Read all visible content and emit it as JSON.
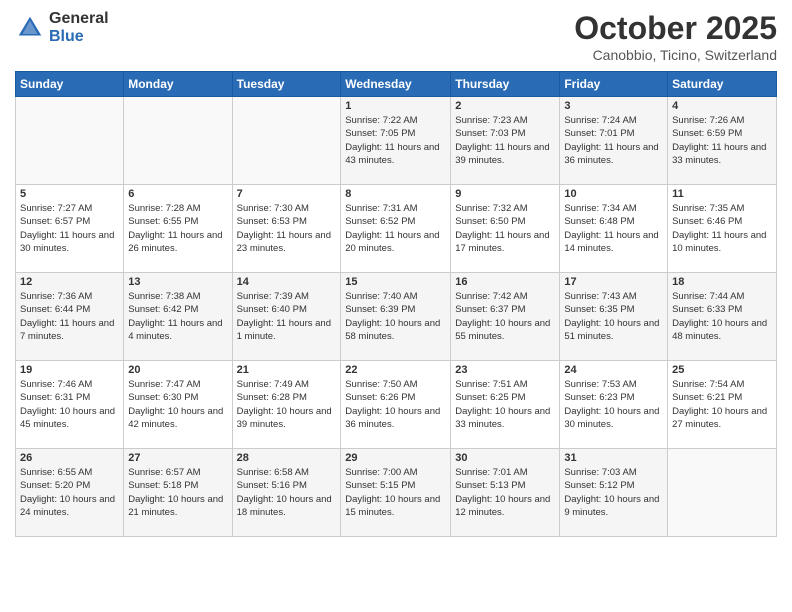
{
  "header": {
    "logo_general": "General",
    "logo_blue": "Blue",
    "title": "October 2025",
    "location": "Canobbio, Ticino, Switzerland"
  },
  "weekdays": [
    "Sunday",
    "Monday",
    "Tuesday",
    "Wednesday",
    "Thursday",
    "Friday",
    "Saturday"
  ],
  "weeks": [
    [
      {
        "day": "",
        "sunrise": "",
        "sunset": "",
        "daylight": ""
      },
      {
        "day": "",
        "sunrise": "",
        "sunset": "",
        "daylight": ""
      },
      {
        "day": "",
        "sunrise": "",
        "sunset": "",
        "daylight": ""
      },
      {
        "day": "1",
        "sunrise": "Sunrise: 7:22 AM",
        "sunset": "Sunset: 7:05 PM",
        "daylight": "Daylight: 11 hours and 43 minutes."
      },
      {
        "day": "2",
        "sunrise": "Sunrise: 7:23 AM",
        "sunset": "Sunset: 7:03 PM",
        "daylight": "Daylight: 11 hours and 39 minutes."
      },
      {
        "day": "3",
        "sunrise": "Sunrise: 7:24 AM",
        "sunset": "Sunset: 7:01 PM",
        "daylight": "Daylight: 11 hours and 36 minutes."
      },
      {
        "day": "4",
        "sunrise": "Sunrise: 7:26 AM",
        "sunset": "Sunset: 6:59 PM",
        "daylight": "Daylight: 11 hours and 33 minutes."
      }
    ],
    [
      {
        "day": "5",
        "sunrise": "Sunrise: 7:27 AM",
        "sunset": "Sunset: 6:57 PM",
        "daylight": "Daylight: 11 hours and 30 minutes."
      },
      {
        "day": "6",
        "sunrise": "Sunrise: 7:28 AM",
        "sunset": "Sunset: 6:55 PM",
        "daylight": "Daylight: 11 hours and 26 minutes."
      },
      {
        "day": "7",
        "sunrise": "Sunrise: 7:30 AM",
        "sunset": "Sunset: 6:53 PM",
        "daylight": "Daylight: 11 hours and 23 minutes."
      },
      {
        "day": "8",
        "sunrise": "Sunrise: 7:31 AM",
        "sunset": "Sunset: 6:52 PM",
        "daylight": "Daylight: 11 hours and 20 minutes."
      },
      {
        "day": "9",
        "sunrise": "Sunrise: 7:32 AM",
        "sunset": "Sunset: 6:50 PM",
        "daylight": "Daylight: 11 hours and 17 minutes."
      },
      {
        "day": "10",
        "sunrise": "Sunrise: 7:34 AM",
        "sunset": "Sunset: 6:48 PM",
        "daylight": "Daylight: 11 hours and 14 minutes."
      },
      {
        "day": "11",
        "sunrise": "Sunrise: 7:35 AM",
        "sunset": "Sunset: 6:46 PM",
        "daylight": "Daylight: 11 hours and 10 minutes."
      }
    ],
    [
      {
        "day": "12",
        "sunrise": "Sunrise: 7:36 AM",
        "sunset": "Sunset: 6:44 PM",
        "daylight": "Daylight: 11 hours and 7 minutes."
      },
      {
        "day": "13",
        "sunrise": "Sunrise: 7:38 AM",
        "sunset": "Sunset: 6:42 PM",
        "daylight": "Daylight: 11 hours and 4 minutes."
      },
      {
        "day": "14",
        "sunrise": "Sunrise: 7:39 AM",
        "sunset": "Sunset: 6:40 PM",
        "daylight": "Daylight: 11 hours and 1 minute."
      },
      {
        "day": "15",
        "sunrise": "Sunrise: 7:40 AM",
        "sunset": "Sunset: 6:39 PM",
        "daylight": "Daylight: 10 hours and 58 minutes."
      },
      {
        "day": "16",
        "sunrise": "Sunrise: 7:42 AM",
        "sunset": "Sunset: 6:37 PM",
        "daylight": "Daylight: 10 hours and 55 minutes."
      },
      {
        "day": "17",
        "sunrise": "Sunrise: 7:43 AM",
        "sunset": "Sunset: 6:35 PM",
        "daylight": "Daylight: 10 hours and 51 minutes."
      },
      {
        "day": "18",
        "sunrise": "Sunrise: 7:44 AM",
        "sunset": "Sunset: 6:33 PM",
        "daylight": "Daylight: 10 hours and 48 minutes."
      }
    ],
    [
      {
        "day": "19",
        "sunrise": "Sunrise: 7:46 AM",
        "sunset": "Sunset: 6:31 PM",
        "daylight": "Daylight: 10 hours and 45 minutes."
      },
      {
        "day": "20",
        "sunrise": "Sunrise: 7:47 AM",
        "sunset": "Sunset: 6:30 PM",
        "daylight": "Daylight: 10 hours and 42 minutes."
      },
      {
        "day": "21",
        "sunrise": "Sunrise: 7:49 AM",
        "sunset": "Sunset: 6:28 PM",
        "daylight": "Daylight: 10 hours and 39 minutes."
      },
      {
        "day": "22",
        "sunrise": "Sunrise: 7:50 AM",
        "sunset": "Sunset: 6:26 PM",
        "daylight": "Daylight: 10 hours and 36 minutes."
      },
      {
        "day": "23",
        "sunrise": "Sunrise: 7:51 AM",
        "sunset": "Sunset: 6:25 PM",
        "daylight": "Daylight: 10 hours and 33 minutes."
      },
      {
        "day": "24",
        "sunrise": "Sunrise: 7:53 AM",
        "sunset": "Sunset: 6:23 PM",
        "daylight": "Daylight: 10 hours and 30 minutes."
      },
      {
        "day": "25",
        "sunrise": "Sunrise: 7:54 AM",
        "sunset": "Sunset: 6:21 PM",
        "daylight": "Daylight: 10 hours and 27 minutes."
      }
    ],
    [
      {
        "day": "26",
        "sunrise": "Sunrise: 6:55 AM",
        "sunset": "Sunset: 5:20 PM",
        "daylight": "Daylight: 10 hours and 24 minutes."
      },
      {
        "day": "27",
        "sunrise": "Sunrise: 6:57 AM",
        "sunset": "Sunset: 5:18 PM",
        "daylight": "Daylight: 10 hours and 21 minutes."
      },
      {
        "day": "28",
        "sunrise": "Sunrise: 6:58 AM",
        "sunset": "Sunset: 5:16 PM",
        "daylight": "Daylight: 10 hours and 18 minutes."
      },
      {
        "day": "29",
        "sunrise": "Sunrise: 7:00 AM",
        "sunset": "Sunset: 5:15 PM",
        "daylight": "Daylight: 10 hours and 15 minutes."
      },
      {
        "day": "30",
        "sunrise": "Sunrise: 7:01 AM",
        "sunset": "Sunset: 5:13 PM",
        "daylight": "Daylight: 10 hours and 12 minutes."
      },
      {
        "day": "31",
        "sunrise": "Sunrise: 7:03 AM",
        "sunset": "Sunset: 5:12 PM",
        "daylight": "Daylight: 10 hours and 9 minutes."
      },
      {
        "day": "",
        "sunrise": "",
        "sunset": "",
        "daylight": ""
      }
    ]
  ]
}
